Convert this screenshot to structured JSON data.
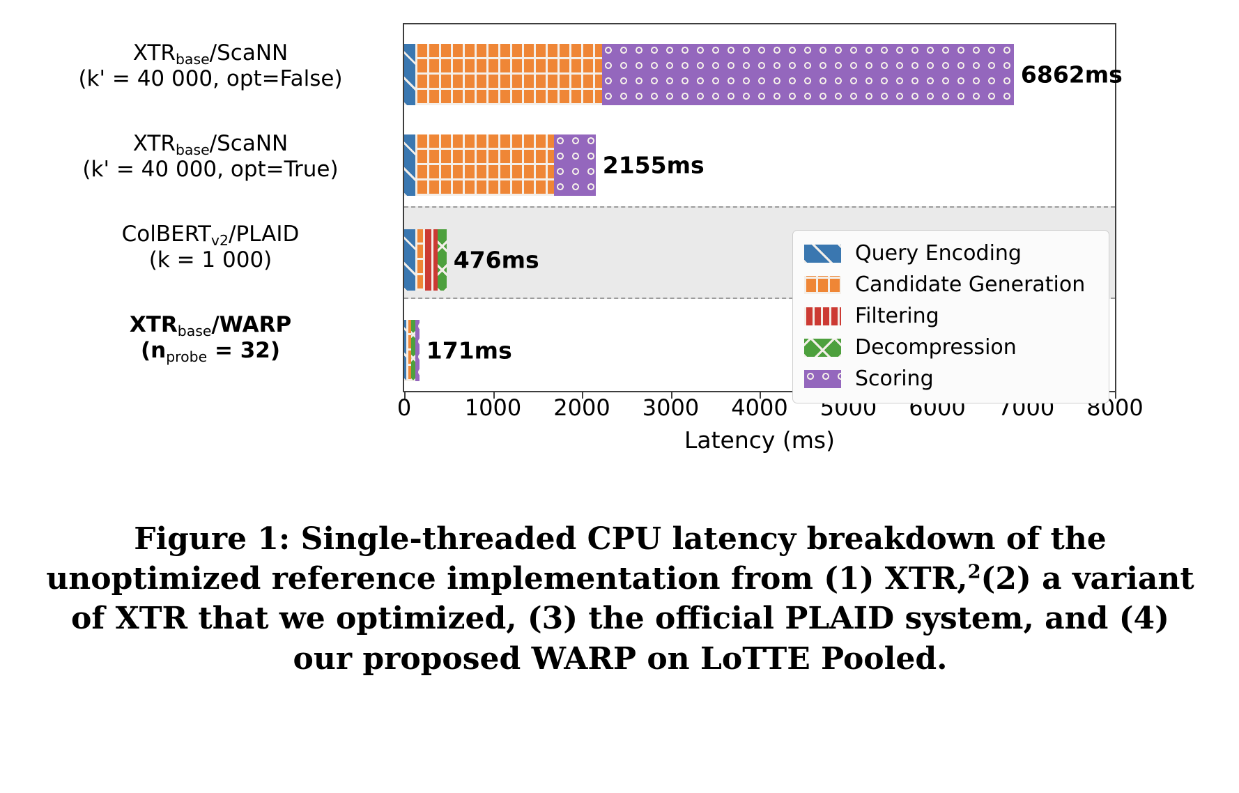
{
  "figure": {
    "caption_prefix": "Figure 1: ",
    "caption_part1": "Single-threaded CPU latency breakdown of the unoptimized reference implementation from (1) XTR,",
    "caption_footnote": "2",
    "caption_part2": "(2) a variant of XTR that we optimized, (3) the official PLAID system, and (4) our proposed WARP on LoTTE Pooled."
  },
  "chart_data": {
    "type": "bar",
    "orientation": "horizontal",
    "title": "",
    "xlabel": "Latency (ms)",
    "ylabel": "",
    "xlim": [
      0,
      8000
    ],
    "xticks": [
      0,
      1000,
      2000,
      3000,
      4000,
      5000,
      6000,
      7000,
      8000
    ],
    "xticklabels": [
      "0",
      "1000",
      "2000",
      "3000",
      "4000",
      "5000",
      "6000",
      "7000",
      "8000"
    ],
    "grid": false,
    "legend_position": "center right",
    "stacked": true,
    "series": [
      {
        "name": "Query Encoding",
        "color": "#3a77b0",
        "hatch": "/",
        "values": [
          125,
          125,
          125,
          22
        ]
      },
      {
        "name": "Candidate Generation",
        "color": "#ef8636",
        "hatch": "+",
        "values": [
          2100,
          1560,
          85,
          55
        ]
      },
      {
        "name": "Filtering",
        "color": "#cc3a33",
        "hatch": "|",
        "values": [
          0,
          0,
          170,
          0
        ]
      },
      {
        "name": "Decompression",
        "color": "#4da03d",
        "hatch": "x",
        "values": [
          0,
          0,
          96,
          52
        ]
      },
      {
        "name": "Scoring",
        "color": "#9467bd",
        "hatch": "o",
        "values": [
          4637,
          470,
          0,
          42
        ]
      }
    ],
    "categories": [
      {
        "line1": "XTR",
        "sub1": "base",
        "line1_tail": "/ScaNN",
        "line2": "(k' = 40 000, opt=False)",
        "bold": false,
        "total": 6862,
        "total_label": "6862ms"
      },
      {
        "line1": "XTR",
        "sub1": "base",
        "line1_tail": "/ScaNN",
        "line2": "(k' = 40 000, opt=True)",
        "bold": false,
        "total": 2155,
        "total_label": "2155ms"
      },
      {
        "line1": "ColBERT",
        "sub1": "v2",
        "line1_tail": "/PLAID",
        "line2": "(k = 1 000)",
        "bold": false,
        "total": 476,
        "total_label": "476ms"
      },
      {
        "line1": "XTR",
        "sub1": "base",
        "line1_tail": "/WARP",
        "line2_pre": "(n",
        "line2_sub": "probe",
        "line2_post": " = 32)",
        "bold": true,
        "total": 171,
        "total_label": "171ms"
      }
    ],
    "legend": [
      {
        "label": "Query Encoding",
        "color": "#3a77b0",
        "hatch": "/"
      },
      {
        "label": "Candidate Generation",
        "color": "#ef8636",
        "hatch": "+"
      },
      {
        "label": "Filtering",
        "color": "#cc3a33",
        "hatch": "|"
      },
      {
        "label": "Decompression",
        "color": "#4da03d",
        "hatch": "x"
      },
      {
        "label": "Scoring",
        "color": "#9467bd",
        "hatch": "o"
      }
    ]
  }
}
